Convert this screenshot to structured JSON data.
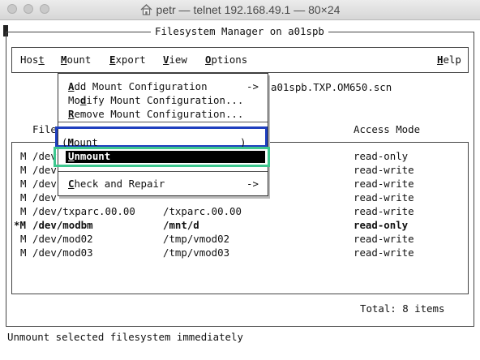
{
  "window": {
    "title": "petr — telnet 192.168.49.1 — 80×24",
    "controls": [
      "close-button",
      "minimize-button",
      "zoom-button"
    ]
  },
  "app": {
    "title": "Filesystem Manager on a01spb"
  },
  "menubar": {
    "items": [
      {
        "pre": "Hos",
        "u": "t",
        "post": ""
      },
      {
        "pre": "",
        "u": "M",
        "post": "ount"
      },
      {
        "pre": "",
        "u": "E",
        "post": "xport"
      },
      {
        "pre": "",
        "u": "V",
        "post": "iew"
      },
      {
        "pre": "",
        "u": "O",
        "post": "ptions"
      }
    ],
    "help": {
      "pre": "",
      "u": "H",
      "post": "elp"
    }
  },
  "config_file": "a01spb.TXP.OM650.scn",
  "table": {
    "columns": [
      "File",
      "Access Mode"
    ],
    "rows": [
      {
        "flag": "M",
        "device": "/dev",
        "mount": "",
        "mode": "read-only",
        "bold": false
      },
      {
        "flag": "M",
        "device": "/dev",
        "mount": "",
        "mode": "read-write",
        "bold": false
      },
      {
        "flag": "M",
        "device": "/dev",
        "mount": "",
        "mode": "read-write",
        "bold": false
      },
      {
        "flag": "M",
        "device": "/dev",
        "mount": "",
        "mode": "read-write",
        "bold": false
      },
      {
        "flag": "M",
        "device": "/dev/txparc.00.00",
        "mount": "/txparc.00.00",
        "mode": "read-write",
        "bold": false
      },
      {
        "flag": "*M",
        "device": "/dev/modbm",
        "mount": "/mnt/d",
        "mode": "read-only",
        "bold": true
      },
      {
        "flag": "M",
        "device": "/dev/mod02",
        "mount": "/tmp/vmod02",
        "mode": "read-write",
        "bold": false
      },
      {
        "flag": "M",
        "device": "/dev/mod03",
        "mount": "/tmp/vmod03",
        "mode": "read-write",
        "bold": false
      }
    ],
    "total": "Total: 8 items"
  },
  "dropdown": {
    "items": [
      {
        "pre": "",
        "u": "A",
        "post": "dd Mount Configuration",
        "arrow": "->"
      },
      {
        "pre": "Mo",
        "u": "d",
        "post": "ify Mount Configuration...",
        "arrow": ""
      },
      {
        "pre": "",
        "u": "R",
        "post": "emove Mount Configuration...",
        "arrow": ""
      }
    ],
    "mount": {
      "open": "(",
      "pre": "",
      "u": "M",
      "post": "ount",
      "close": ")"
    },
    "unmount": {
      "pre": "",
      "u": "U",
      "post": "nmount"
    },
    "check": {
      "pre": "",
      "u": "C",
      "post": "heck and Repair",
      "arrow": "->"
    }
  },
  "status_line": "Unmount selected filesystem immediately",
  "colors": {
    "mount_highlight": "#1f3fbf",
    "unmount_highlight": "#3ec78f",
    "selection_bg": "#000000"
  }
}
